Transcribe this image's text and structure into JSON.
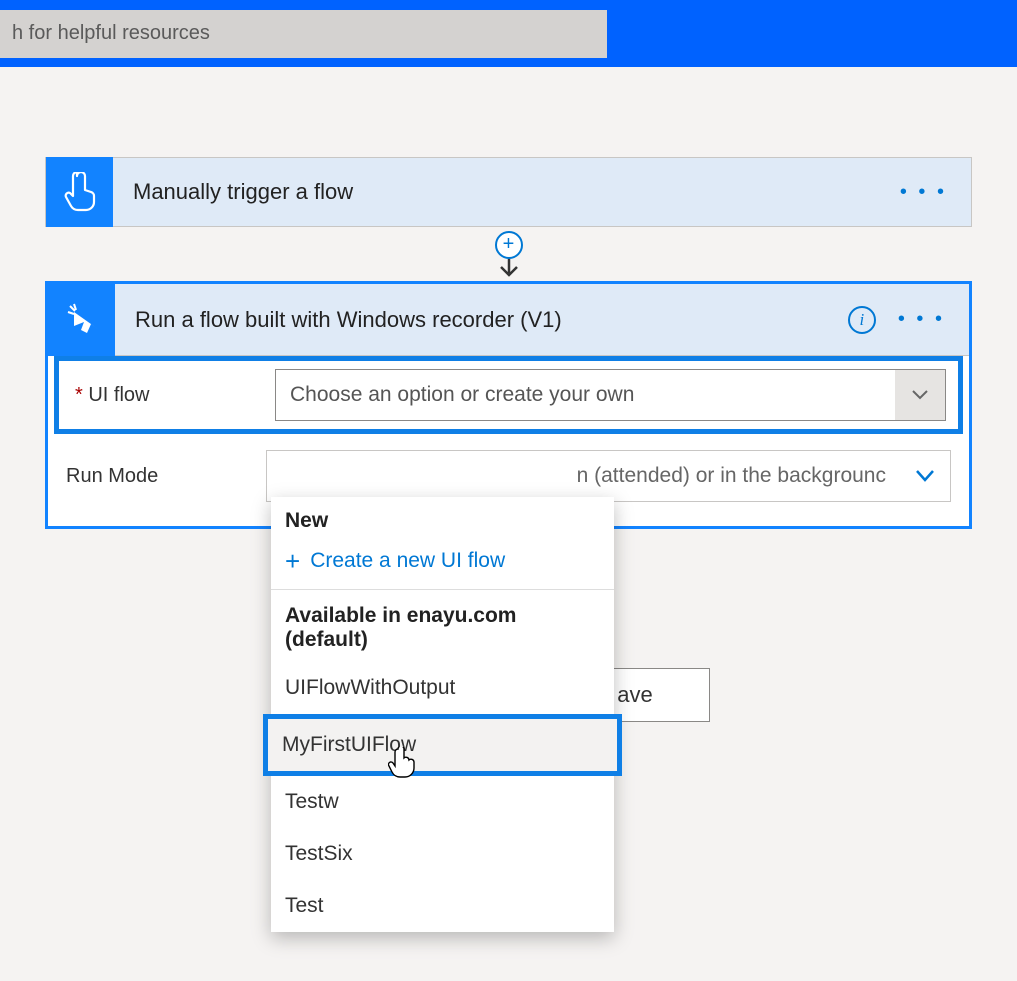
{
  "search": {
    "placeholder": "h for helpful resources"
  },
  "trigger": {
    "title": "Manually trigger a flow"
  },
  "action": {
    "title": "Run a flow built with Windows recorder (V1)",
    "fields": {
      "uiflow": {
        "label": " UI flow",
        "placeholder": "Choose an option or create your own"
      },
      "runmode": {
        "label": "Run Mode",
        "placeholder": "n (attended) or in the backgrounc"
      }
    }
  },
  "dropdown": {
    "new_label": "New",
    "create_label": "Create a new UI flow",
    "section_label": "Available in enayu.com (default)",
    "items": [
      "UIFlowWithOutput",
      "MyFirstUIFlow",
      "Testw",
      "TestSix",
      "Test"
    ]
  },
  "save_label": "ave"
}
